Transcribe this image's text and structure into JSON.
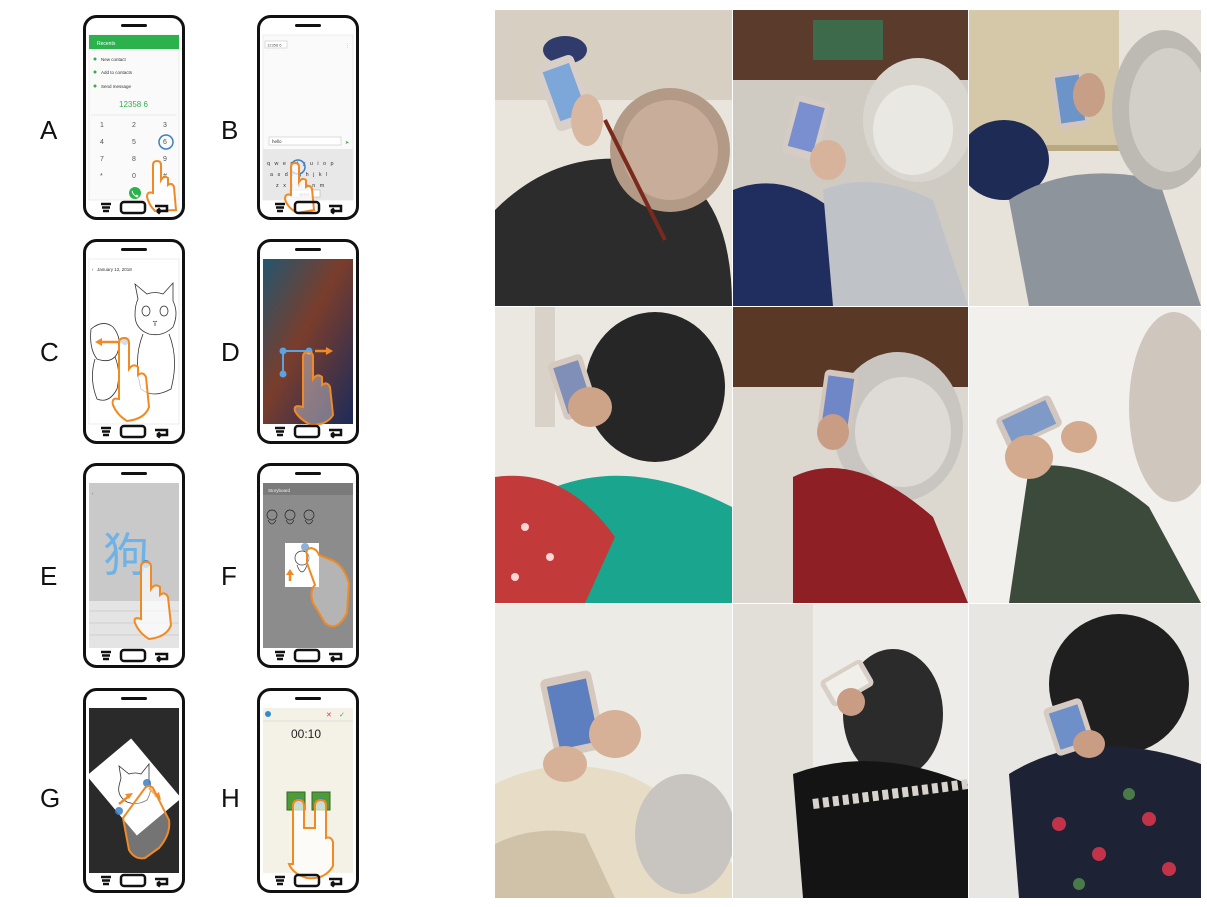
{
  "labels": [
    "A",
    "B",
    "C",
    "D",
    "E",
    "F",
    "G",
    "H"
  ],
  "panel_a": {
    "header": "Recents",
    "menu": [
      "New contact",
      "Add to contacts",
      "Send message"
    ],
    "number": "12358 6",
    "keys": [
      "1",
      "2",
      "3",
      "4",
      "5",
      "6",
      "7",
      "8",
      "9",
      "*",
      "0",
      "#"
    ]
  },
  "panel_b": {
    "recipient": "12358 6",
    "message": "hello",
    "keyboard_row1": "q w e r t y u i o p",
    "keyboard_row2": "a s d f g h j k l",
    "keyboard_row3": "z x c v b n m",
    "space": "space"
  },
  "panel_c": {
    "date": "January 12, 2018"
  },
  "panel_e": {
    "character": "狗"
  },
  "panel_f": {
    "title": "Storyboard"
  },
  "panel_h": {
    "timer": "00:10"
  },
  "colors": {
    "accent": "#f08a24",
    "touch": "#3b7fc4",
    "android_green": "#2bb24c",
    "phone_stroke": "#111111"
  }
}
